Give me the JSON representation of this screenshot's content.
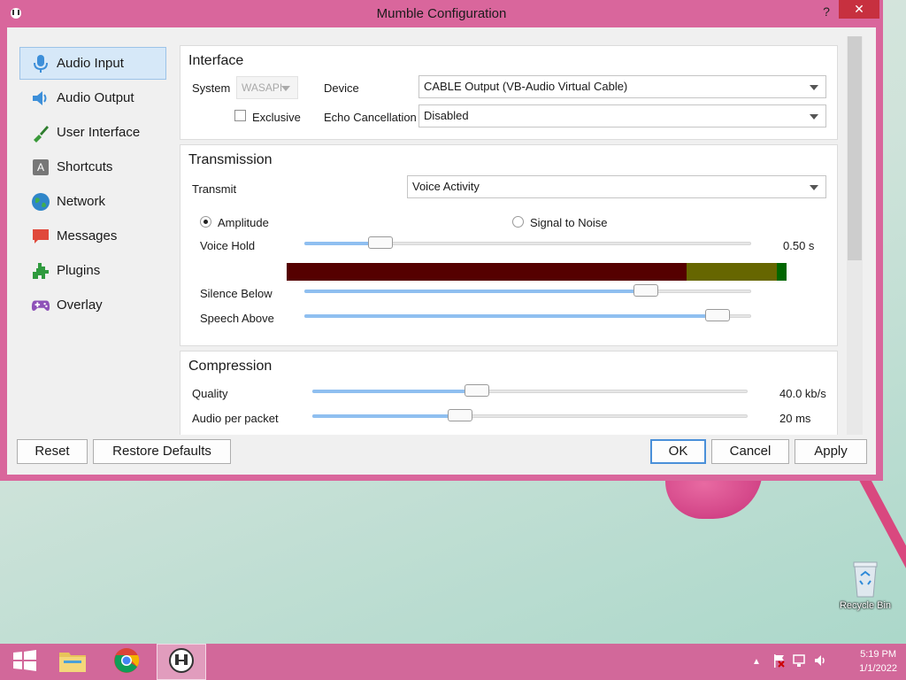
{
  "window": {
    "title": "Mumble Configuration",
    "help_label": "?",
    "close_label": "✕"
  },
  "sidebar": {
    "items": [
      {
        "label": "Audio Input",
        "icon": "microphone-icon",
        "active": true
      },
      {
        "label": "Audio Output",
        "icon": "speaker-icon"
      },
      {
        "label": "User Interface",
        "icon": "brush-icon"
      },
      {
        "label": "Shortcuts",
        "icon": "keyboard-key-icon"
      },
      {
        "label": "Network",
        "icon": "globe-icon"
      },
      {
        "label": "Messages",
        "icon": "chat-bubble-icon"
      },
      {
        "label": "Plugins",
        "icon": "puzzle-icon"
      },
      {
        "label": "Overlay",
        "icon": "gamepad-icon"
      }
    ],
    "shortcut_key_letter": "A"
  },
  "interface": {
    "title": "Interface",
    "system_label": "System",
    "system_value": "WASAPI",
    "device_label": "Device",
    "device_value": "CABLE Output (VB-Audio Virtual Cable)",
    "exclusive_label": "Exclusive",
    "exclusive_checked": false,
    "echo_label": "Echo Cancellation",
    "echo_value": "Disabled"
  },
  "transmission": {
    "title": "Transmission",
    "transmit_label": "Transmit",
    "transmit_value": "Voice Activity",
    "amplitude_label": "Amplitude",
    "signal_noise_label": "Signal to Noise",
    "selected_mode": "Amplitude",
    "voice_hold_label": "Voice Hold",
    "voice_hold_value": "0.50 s",
    "voice_hold_level": 0.15,
    "silence_below_label": "Silence Below",
    "silence_below_level": 0.78,
    "speech_above_label": "Speech Above",
    "speech_above_level": 0.95,
    "meter_colors": {
      "silence": "#550000",
      "between": "#666600",
      "speech": "#006600"
    }
  },
  "compression": {
    "title": "Compression",
    "quality_label": "Quality",
    "quality_value": "40.0 kb/s",
    "quality_level": 0.37,
    "packet_label": "Audio per packet",
    "packet_value": "20 ms",
    "packet_level": 0.33
  },
  "buttons": {
    "reset": "Reset",
    "restore_defaults": "Restore Defaults",
    "ok": "OK",
    "cancel": "Cancel",
    "apply": "Apply"
  },
  "desktop": {
    "recycle_bin_label": "Recycle Bin"
  },
  "taskbar": {
    "apps": [
      "windows-start-icon",
      "file-explorer-icon",
      "chrome-icon",
      "mumble-icon"
    ],
    "time": "5:19 PM",
    "date": "1/1/2022"
  },
  "colors": {
    "accent": "#d9669c",
    "close": "#c7303f",
    "selection": "#d6e8f8"
  }
}
